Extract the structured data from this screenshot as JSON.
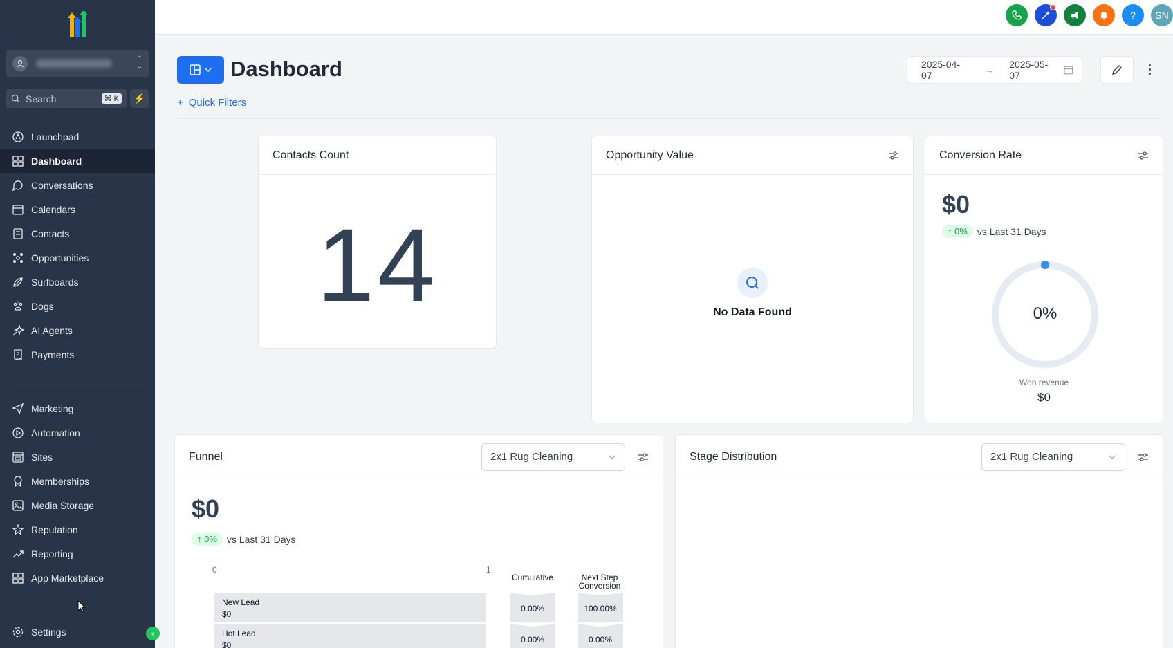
{
  "sidebar": {
    "search": {
      "label": "Search",
      "shortcut": "⌘ K"
    },
    "items_top": [
      {
        "label": "Launchpad",
        "icon": "launchpad-icon"
      },
      {
        "label": "Dashboard",
        "icon": "dashboard-icon",
        "active": true
      },
      {
        "label": "Conversations",
        "icon": "chat-icon"
      },
      {
        "label": "Calendars",
        "icon": "calendar-icon"
      },
      {
        "label": "Contacts",
        "icon": "contacts-icon"
      },
      {
        "label": "Opportunities",
        "icon": "opportunities-icon"
      },
      {
        "label": "Surfboards",
        "icon": "surfboard-icon"
      },
      {
        "label": "Dogs",
        "icon": "paw-icon"
      },
      {
        "label": "AI Agents",
        "icon": "sparkle-icon"
      },
      {
        "label": "Payments",
        "icon": "receipt-icon"
      }
    ],
    "items_bottom": [
      {
        "label": "Marketing",
        "icon": "send-icon"
      },
      {
        "label": "Automation",
        "icon": "automation-icon"
      },
      {
        "label": "Sites",
        "icon": "sites-icon"
      },
      {
        "label": "Memberships",
        "icon": "award-icon"
      },
      {
        "label": "Media Storage",
        "icon": "image-icon"
      },
      {
        "label": "Reputation",
        "icon": "star-icon"
      },
      {
        "label": "Reporting",
        "icon": "trend-icon"
      },
      {
        "label": "App Marketplace",
        "icon": "apps-icon"
      }
    ],
    "settings": {
      "label": "Settings",
      "icon": "gear-icon"
    }
  },
  "topbar": {
    "icons": [
      {
        "name": "phone-icon",
        "color": "#16a34a",
        "glyph": ""
      },
      {
        "name": "magic-icon",
        "color": "#1d4ed8",
        "glyph": ""
      },
      {
        "name": "megaphone-icon",
        "color": "#15803d",
        "glyph": ""
      },
      {
        "name": "bell-icon",
        "color": "#f97316",
        "glyph": ""
      },
      {
        "name": "help-icon",
        "color": "#1d8cf2",
        "glyph": "?"
      },
      {
        "name": "user-avatar",
        "color": "#60a5b6",
        "glyph": "SN"
      }
    ]
  },
  "header": {
    "title": "Dashboard",
    "quick_filters": "Quick Filters",
    "date_start": "2025-04-07",
    "date_end": "2025-05-07"
  },
  "cards": {
    "contacts": {
      "title": "Contacts Count",
      "value": "14"
    },
    "opportunity": {
      "title": "Opportunity Value",
      "empty": "No Data Found"
    },
    "conversion": {
      "title": "Conversion Rate",
      "value": "$0",
      "trend": "↑ 0%",
      "trend_label": "vs Last 31 Days",
      "donut_percent": "0%",
      "won_label": "Won revenue",
      "won_value": "$0"
    },
    "funnel": {
      "title": "Funnel",
      "select": "2x1 Rug Cleaning",
      "value": "$0",
      "trend": "↑ 0%",
      "trend_label": "vs Last 31 Days",
      "axis_min": "0",
      "axis_max": "1",
      "col_cumulative": "Cumulative",
      "col_next": "Next Step Conversion",
      "rows": [
        {
          "stage": "New Lead",
          "amount": "$0",
          "cumulative": "0.00%",
          "next": "100.00%"
        },
        {
          "stage": "Hot Lead",
          "amount": "$0",
          "cumulative": "0.00%",
          "next": "0.00%"
        }
      ]
    },
    "stage": {
      "title": "Stage Distribution",
      "select": "2x1 Rug Cleaning"
    }
  },
  "colors": {
    "accent": "#1d6ff2",
    "sidebar_bg": "#283548",
    "success": "#16a34a"
  }
}
